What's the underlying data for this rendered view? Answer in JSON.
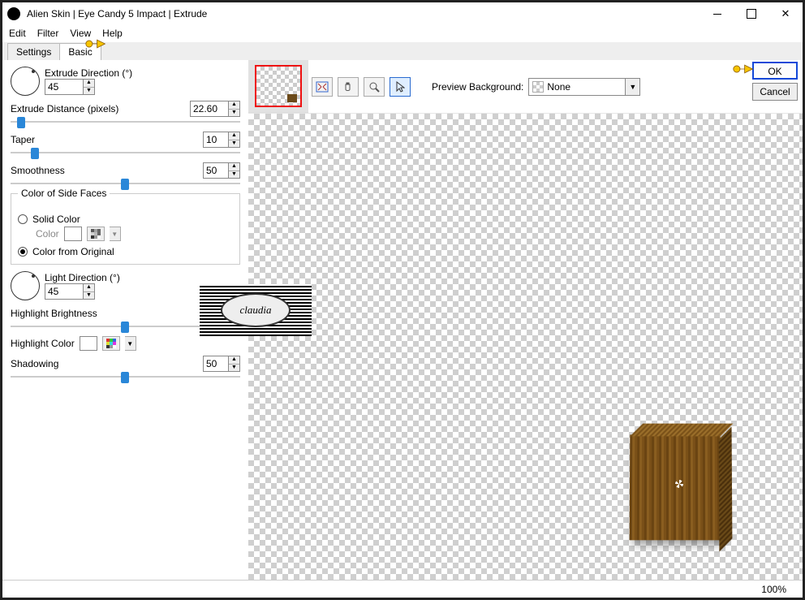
{
  "window": {
    "title": "Alien Skin | Eye Candy 5 Impact | Extrude"
  },
  "menu": {
    "edit": "Edit",
    "filter": "Filter",
    "view": "View",
    "help": "Help"
  },
  "tabs": {
    "settings": "Settings",
    "basic": "Basic"
  },
  "panel": {
    "extrude_direction_label": "Extrude Direction (°)",
    "extrude_direction_value": "45",
    "extrude_distance_label": "Extrude Distance (pixels)",
    "extrude_distance_value": "22.60",
    "taper_label": "Taper",
    "taper_value": "10",
    "smoothness_label": "Smoothness",
    "smoothness_value": "50",
    "color_group_title": "Color of Side Faces",
    "solid_color_label": "Solid Color",
    "color_label": "Color",
    "color_from_original_label": "Color from Original",
    "light_direction_label": "Light Direction (°)",
    "light_direction_value": "45",
    "highlight_brightness_label": "Highlight Brightness",
    "highlight_brightness_value": "50",
    "highlight_color_label": "Highlight Color",
    "shadowing_label": "Shadowing",
    "shadowing_value": "50"
  },
  "toolbar": {
    "preview_bg_label": "Preview Background:",
    "preview_bg_value": "None"
  },
  "buttons": {
    "ok": "OK",
    "cancel": "Cancel"
  },
  "status": {
    "zoom": "100%"
  },
  "watermark": {
    "text": "claudia"
  }
}
